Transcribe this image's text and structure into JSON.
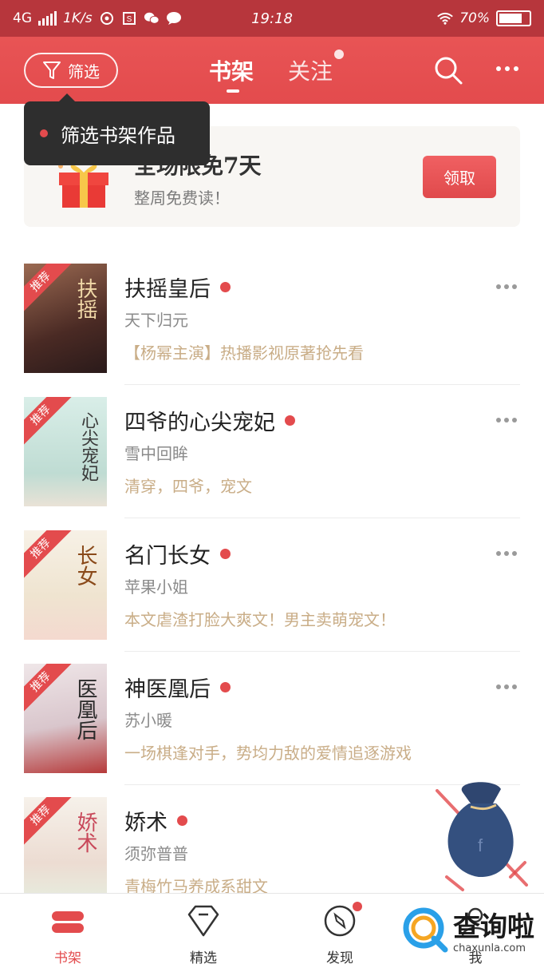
{
  "status_bar": {
    "network": "4G",
    "speed": "1K/s",
    "time": "19:18",
    "battery": "70%"
  },
  "top_nav": {
    "filter_label": "筛选",
    "tabs": [
      {
        "label": "书架",
        "active": true
      },
      {
        "label": "关注",
        "active": false,
        "has_dot": true
      }
    ],
    "search_icon": "search-icon",
    "more_icon": "more-icon"
  },
  "tooltip": {
    "text": "筛选书架作品"
  },
  "promo": {
    "title": "全场限免7天",
    "subtitle": "整周免费读！",
    "button_label": "领取"
  },
  "books": [
    {
      "cover_tag": "推荐",
      "cover_text": "扶摇",
      "title": "扶摇皇后",
      "author": "天下归元",
      "desc": "【杨幂主演】热播影视原著抢先看",
      "cover_color": "#7a4a3a"
    },
    {
      "cover_tag": "推荐",
      "cover_text": "心尖宠妃",
      "title": "四爷的心尖宠妃",
      "author": "雪中回眸",
      "desc": "清穿，四爷，宠文",
      "cover_color": "#cfe6df"
    },
    {
      "cover_tag": "推荐",
      "cover_text": "长女",
      "title": "名门长女",
      "author": "苹果小姐",
      "desc": "本文虐渣打脸大爽文！男主卖萌宠文！",
      "cover_color": "#f3ede2"
    },
    {
      "cover_tag": "推荐",
      "cover_text": "医凰后",
      "title": "神医凰后",
      "author": "苏小暖",
      "desc": "一场棋逢对手，势均力敌的爱情追逐游戏",
      "cover_color": "#e9dde0"
    },
    {
      "cover_tag": "推荐",
      "cover_text": "娇术",
      "title": "娇术",
      "author": "须弥普普",
      "desc": "青梅竹马养成系甜文",
      "cover_color": "#f4efe6"
    }
  ],
  "tabbar": [
    {
      "label": "书架",
      "icon": "bookshelf-icon",
      "active": true
    },
    {
      "label": "精选",
      "icon": "diamond-icon",
      "active": false
    },
    {
      "label": "发现",
      "icon": "compass-icon",
      "active": false,
      "has_dot": true
    },
    {
      "label": "我",
      "icon": "person-icon",
      "active": false
    }
  ],
  "watermark": {
    "cn": "查询啦",
    "en": "chaxunla.com"
  },
  "colors": {
    "brand_red": "#e34b4d",
    "status_bar": "#b7363c",
    "desc_gold": "#c9ad87"
  }
}
